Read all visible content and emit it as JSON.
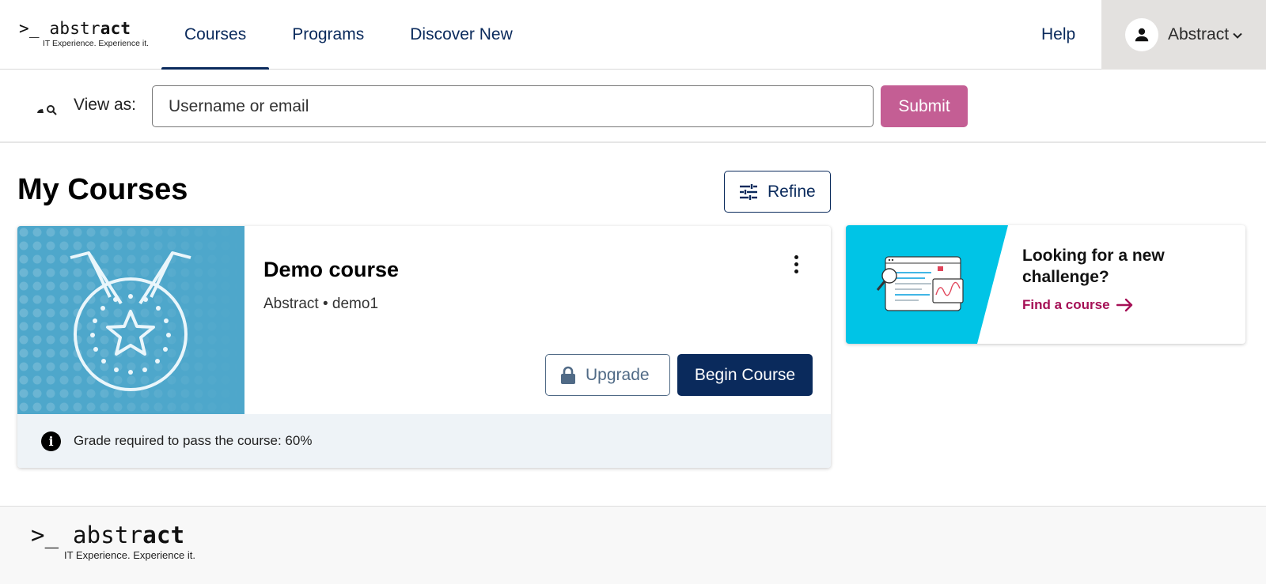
{
  "brand": {
    "logo_prefix": ">_ abstr",
    "logo_bold": "act",
    "tagline": "IT Experience. Experience it."
  },
  "nav": {
    "items": [
      {
        "label": "Courses",
        "active": true
      },
      {
        "label": "Programs",
        "active": false
      },
      {
        "label": "Discover New",
        "active": false
      }
    ],
    "help_label": "Help",
    "user_name": "Abstract"
  },
  "view_as": {
    "label": "View as:",
    "placeholder": "Username or email",
    "value": "",
    "submit_label": "Submit"
  },
  "main": {
    "title": "My Courses",
    "refine_label": "Refine"
  },
  "course": {
    "title": "Demo course",
    "org": "Abstract",
    "separator": "•",
    "code": "demo1",
    "upgrade_label": "Upgrade",
    "begin_label": "Begin Course",
    "grade_text": "Grade required to pass the course: 60%",
    "image_icon": "medal-star-icon"
  },
  "promo": {
    "title": "Looking for a new challenge?",
    "link_label": "Find a course"
  },
  "colors": {
    "primary": "#0a2a5c",
    "submit": "#c45e94",
    "link_accent": "#a51056",
    "course_image_bg": "#4ea7cb",
    "promo_bg": "#00c4e6",
    "user_menu_bg": "#e3e1df"
  }
}
